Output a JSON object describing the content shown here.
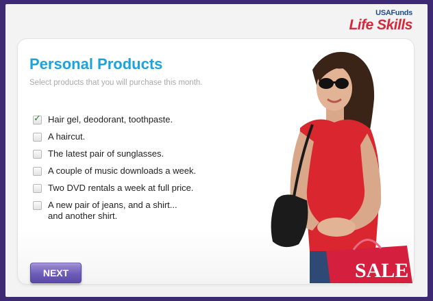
{
  "brand": {
    "small": "USAFunds",
    "big": "Life Skills"
  },
  "page": {
    "title": "Personal Products",
    "subtitle": "Select products that you will purchase this month."
  },
  "options": [
    {
      "label": "Hair gel, deodorant, toothpaste.",
      "checked": true
    },
    {
      "label": "A haircut.",
      "checked": false
    },
    {
      "label": "The latest pair of sunglasses.",
      "checked": false
    },
    {
      "label": "A couple of music downloads a week.",
      "checked": false
    },
    {
      "label": "Two DVD rentals a week at full price.",
      "checked": false
    },
    {
      "label": "A new pair of jeans, and a shirt...\nand another shirt.",
      "checked": false
    }
  ],
  "next_label": "NEXT",
  "photo": {
    "bag_text": "SALE"
  },
  "colors": {
    "background": "#3e2a73",
    "title": "#1aa3dd",
    "brand_red": "#d3293c",
    "button": "#6e5db8",
    "shirt": "#d9262f"
  },
  "icons": {
    "checkbox_checked": "checkmark-icon"
  }
}
